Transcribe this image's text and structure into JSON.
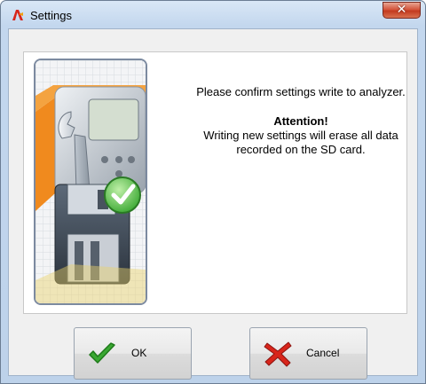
{
  "window": {
    "title": "Settings",
    "close_symbol": "✕",
    "app_icon": "app-logo-icon"
  },
  "message": {
    "line1": "Please confirm settings write to analyzer.",
    "attention": "Attention!",
    "warning": "Writing new settings will erase all data recorded on the SD card."
  },
  "illustration": {
    "icon": "settings-write-sd-illustration"
  },
  "buttons": {
    "ok": {
      "label": "OK",
      "icon": "check-mark-icon"
    },
    "cancel": {
      "label": "Cancel",
      "icon": "red-x-icon"
    }
  },
  "colors": {
    "accent_check": "#3aa832",
    "accent_cancel": "#d8251b",
    "close_button": "#c94a2f"
  }
}
